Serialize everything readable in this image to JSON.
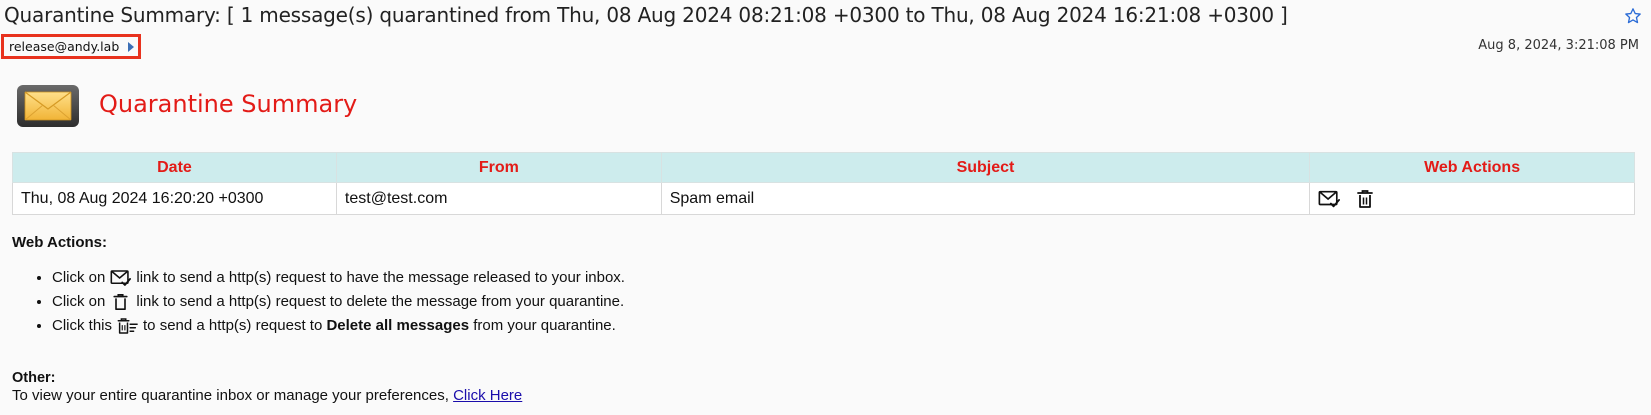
{
  "email": {
    "subject": "Quarantine Summary: [ 1 message(s) quarantined from Thu, 08 Aug 2024 08:21:08 +0300 to Thu, 08 Aug 2024 16:21:08 +0300 ]",
    "sender": "release@andy.lab",
    "date": "Aug 8, 2024, 3:21:08 PM"
  },
  "summary": {
    "title": "Quarantine Summary"
  },
  "table": {
    "headers": [
      "Date",
      "From",
      "Subject",
      "Web Actions"
    ],
    "rows": [
      {
        "date": "Thu, 08 Aug 2024 16:20:20 +0300",
        "from": "test@test.com",
        "subject": "Spam email"
      }
    ]
  },
  "web_actions": {
    "heading": "Web Actions:",
    "items": [
      {
        "before": "Click on",
        "icon": "release-icon",
        "after": "link to send a http(s) request to have the message released to your inbox."
      },
      {
        "before": "Click on",
        "icon": "trash-icon",
        "after": "link to send a http(s) request to delete the message from your quarantine."
      },
      {
        "before": "Click this",
        "icon": "delete-all-icon",
        "after": "to send a http(s) request to",
        "bold": "Delete all messages",
        "tail": "from your quarantine."
      }
    ]
  },
  "other": {
    "heading": "Other:",
    "text": "To view your entire quarantine inbox or manage your preferences,",
    "link": "Click Here"
  },
  "colors": {
    "accent_red": "#e31b17",
    "header_bg": "#cdeced",
    "highlight_border": "#e8321e",
    "link": "#1a0dab"
  }
}
